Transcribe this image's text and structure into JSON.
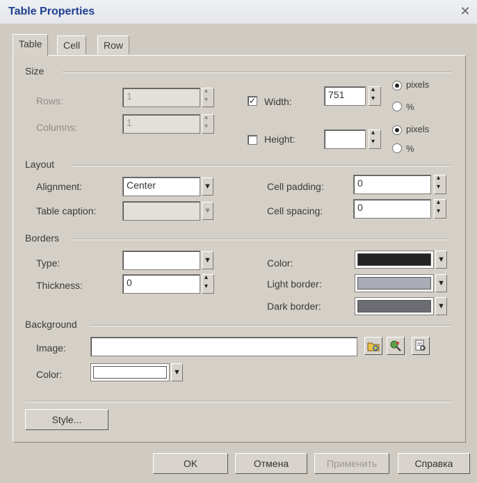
{
  "window": {
    "title": "Table Properties",
    "close_glyph": "✕"
  },
  "tabs": [
    {
      "label": "Table"
    },
    {
      "label": "Cell"
    },
    {
      "label": "Row"
    }
  ],
  "size": {
    "heading": "Size",
    "rows_label": "Rows:",
    "rows_value": "1",
    "columns_label": "Columns:",
    "columns_value": "1",
    "width_label": "Width:",
    "width_checked": "✓",
    "width_value": "751",
    "width_units": {
      "pixels": "pixels",
      "percent": "%"
    },
    "height_label": "Height:",
    "height_value": "",
    "height_units": {
      "pixels": "pixels",
      "percent": "%"
    }
  },
  "layout": {
    "heading": "Layout",
    "alignment_label": "Alignment:",
    "alignment_value": "Center",
    "caption_label": "Table caption:",
    "caption_value": "",
    "padding_label": "Cell padding:",
    "padding_value": "0",
    "spacing_label": "Cell spacing:",
    "spacing_value": "0"
  },
  "borders": {
    "heading": "Borders",
    "type_label": "Type:",
    "type_value": "",
    "thickness_label": "Thickness:",
    "thickness_value": "0",
    "color_label": "Color:",
    "color": "#232323",
    "light_label": "Light border:",
    "light_color": "#a9acb4",
    "dark_label": "Dark border:",
    "dark_color": "#6c6d72"
  },
  "background": {
    "heading": "Background",
    "image_label": "Image:",
    "image_value": "",
    "color_label": "Color:",
    "color": "#ffffff"
  },
  "style_button": "Style...",
  "footer": {
    "ok": "OK",
    "cancel": "Отмена",
    "apply": "Применить",
    "help": "Справка"
  }
}
